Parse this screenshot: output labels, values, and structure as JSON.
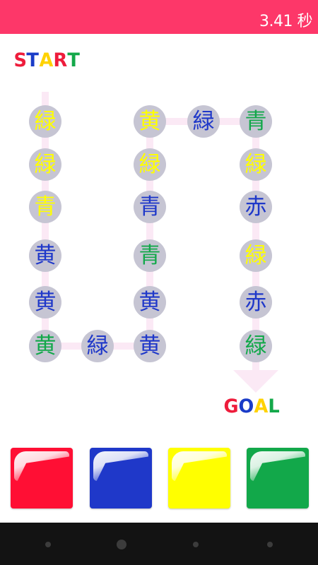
{
  "timer": {
    "text": "3.41 秒"
  },
  "start_label": {
    "letters": [
      {
        "char": "S",
        "color": "#ee1c3b"
      },
      {
        "char": "T",
        "color": "#1a3cc8"
      },
      {
        "char": "A",
        "color": "#ffd200"
      },
      {
        "char": "R",
        "color": "#ee1c3b"
      },
      {
        "char": "T",
        "color": "#14a84a"
      }
    ]
  },
  "goal_label": {
    "letters": [
      {
        "char": "G",
        "color": "#ee1c3b"
      },
      {
        "char": "O",
        "color": "#1a3cc8"
      },
      {
        "char": "A",
        "color": "#ffd200"
      },
      {
        "char": "L",
        "color": "#14a84a"
      }
    ]
  },
  "colors": {
    "red": "#ff0f34",
    "blue": "#1f38c9",
    "yellow": "#ffff00",
    "green": "#12a84a",
    "node_bg": "#c6c5d3",
    "path": "#fbe9f5",
    "topbar": "#fd3769"
  },
  "nodes": [
    {
      "char": "緑",
      "color": "yellow",
      "row": 0,
      "col": 0
    },
    {
      "char": "緑",
      "color": "yellow",
      "row": 1,
      "col": 0
    },
    {
      "char": "青",
      "color": "yellow",
      "row": 2,
      "col": 0
    },
    {
      "char": "黄",
      "color": "blue",
      "row": 3,
      "col": 0
    },
    {
      "char": "黄",
      "color": "blue",
      "row": 4,
      "col": 0
    },
    {
      "char": "黄",
      "color": "green",
      "row": 5,
      "col": 0
    },
    {
      "char": "緑",
      "color": "blue",
      "row": 5,
      "col": 1
    },
    {
      "char": "黄",
      "color": "blue",
      "row": 5,
      "col": 2
    },
    {
      "char": "黄",
      "color": "blue",
      "row": 4,
      "col": 2
    },
    {
      "char": "青",
      "color": "green",
      "row": 3,
      "col": 2
    },
    {
      "char": "青",
      "color": "blue",
      "row": 2,
      "col": 2
    },
    {
      "char": "緑",
      "color": "yellow",
      "row": 1,
      "col": 2
    },
    {
      "char": "黄",
      "color": "yellow",
      "row": 0,
      "col": 2
    },
    {
      "char": "緑",
      "color": "blue",
      "row": 0,
      "col": 3
    },
    {
      "char": "青",
      "color": "green",
      "row": 0,
      "col": 4
    },
    {
      "char": "緑",
      "color": "yellow",
      "row": 1,
      "col": 4
    },
    {
      "char": "赤",
      "color": "blue",
      "row": 2,
      "col": 4
    },
    {
      "char": "緑",
      "color": "yellow",
      "row": 3,
      "col": 4
    },
    {
      "char": "赤",
      "color": "blue",
      "row": 4,
      "col": 4
    },
    {
      "char": "緑",
      "color": "green",
      "row": 5,
      "col": 4
    }
  ],
  "answer_buttons": [
    {
      "name": "red-button",
      "color": "red"
    },
    {
      "name": "blue-button",
      "color": "blue"
    },
    {
      "name": "yellow-button",
      "color": "yellow"
    },
    {
      "name": "green-button",
      "color": "green"
    }
  ],
  "nav_icons": [
    "back-icon",
    "home-icon",
    "recent-apps-icon",
    "menu-icon"
  ]
}
